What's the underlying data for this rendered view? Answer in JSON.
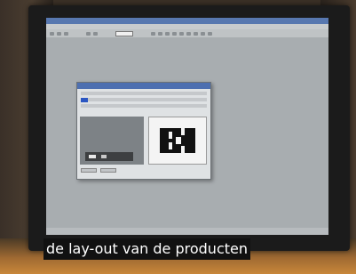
{
  "caption": {
    "text": "de lay-out van de producten"
  },
  "colors": {
    "screen": "#a1a7ab",
    "titlebar": "#5878b0",
    "caption_bg": "#111111",
    "caption_text": "#ffffff"
  },
  "icons": [
    "toolbar-button-icon",
    "selection-indicator-icon"
  ]
}
